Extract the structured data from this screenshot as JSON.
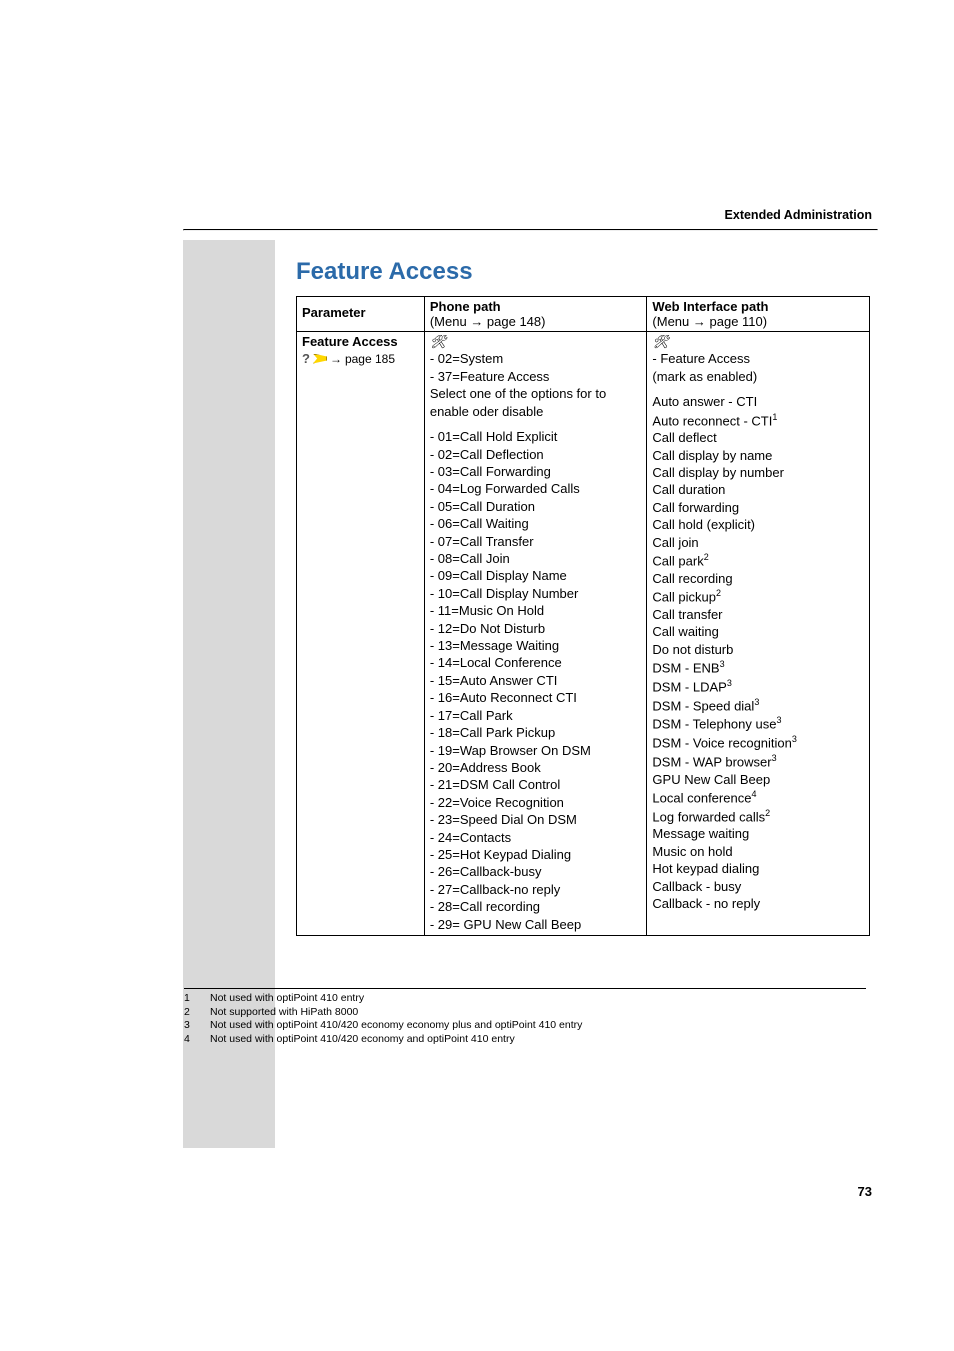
{
  "header": "Extended Administration",
  "title": "Feature Access",
  "columns": {
    "param": "Parameter",
    "phone": "Phone path",
    "phone_sub_prefix": "(Menu ",
    "phone_sub_page": " page 148)",
    "web": "Web Interface path",
    "web_sub_prefix": "(Menu ",
    "web_sub_page": " page 110)"
  },
  "row": {
    "param_title": "Feature Access",
    "param_link_prefix": " ",
    "param_link": "page 185",
    "phone_intro": [
      "- 02=System",
      "- 37=Feature Access",
      "Select one of the options for to enable oder disable"
    ],
    "phone_options": [
      "- 01=Call Hold Explicit",
      "- 02=Call Deflection",
      "- 03=Call Forwarding",
      "- 04=Log Forwarded Calls",
      "- 05=Call Duration",
      "- 06=Call Waiting",
      "- 07=Call Transfer",
      "- 08=Call Join",
      "- 09=Call Display Name",
      "- 10=Call Display Number",
      "- 11=Music On Hold",
      "- 12=Do Not Disturb",
      "- 13=Message Waiting",
      "- 14=Local Conference",
      "- 15=Auto Answer CTI",
      "- 16=Auto Reconnect CTI",
      "- 17=Call Park",
      "- 18=Call Park Pickup",
      "- 19=Wap Browser On DSM",
      "- 20=Address Book",
      "- 21=DSM Call Control",
      "- 22=Voice Recognition",
      "- 23=Speed Dial On DSM",
      "- 24=Contacts",
      "- 25=Hot Keypad Dialing",
      "- 26=Callback-busy",
      "- 27=Callback-no reply",
      "- 28=Call recording",
      "- 29= GPU New Call Beep"
    ],
    "web_intro": [
      "- Feature Access",
      "(mark as enabled)"
    ],
    "web_options": [
      {
        "t": "Auto answer - CTI",
        "s": ""
      },
      {
        "t": "Auto reconnect - CTI",
        "s": "1"
      },
      {
        "t": "Call deflect",
        "s": ""
      },
      {
        "t": "Call display by name",
        "s": ""
      },
      {
        "t": "Call display by number",
        "s": ""
      },
      {
        "t": "Call duration",
        "s": ""
      },
      {
        "t": "Call forwarding",
        "s": ""
      },
      {
        "t": "Call hold (explicit)",
        "s": ""
      },
      {
        "t": "Call join",
        "s": ""
      },
      {
        "t": "Call park",
        "s": "2"
      },
      {
        "t": "Call recording",
        "s": ""
      },
      {
        "t": "Call pickup",
        "s": "2"
      },
      {
        "t": "Call transfer",
        "s": ""
      },
      {
        "t": "Call waiting",
        "s": ""
      },
      {
        "t": "Do not disturb",
        "s": ""
      },
      {
        "t": "DSM - ENB",
        "s": "3"
      },
      {
        "t": "DSM - LDAP",
        "s": "3"
      },
      {
        "t": "DSM - Speed dial",
        "s": "3"
      },
      {
        "t": "DSM - Telephony use",
        "s": "3"
      },
      {
        "t": "DSM - Voice recognition",
        "s": "3"
      },
      {
        "t": "DSM - WAP browser",
        "s": "3"
      },
      {
        "t": "GPU New Call Beep",
        "s": ""
      },
      {
        "t": "Local conference",
        "s": "4"
      },
      {
        "t": "Log forwarded calls",
        "s": "2"
      },
      {
        "t": "Message waiting",
        "s": ""
      },
      {
        "t": "Music on hold",
        "s": ""
      },
      {
        "t": "Hot keypad dialing",
        "s": ""
      },
      {
        "t": "Callback - busy",
        "s": ""
      },
      {
        "t": "Callback - no reply",
        "s": ""
      }
    ]
  },
  "footnotes": [
    {
      "n": "1",
      "t": "Not used with optiPoint 410 entry"
    },
    {
      "n": "2",
      "t": "Not supported with HiPath 8000"
    },
    {
      "n": "3",
      "t": "Not used with optiPoint 410/420 economy economy plus and optiPoint 410 entry"
    },
    {
      "n": "4",
      "t": "Not used with optiPoint 410/420 economy and optiPoint 410 entry"
    }
  ],
  "page_number": "73",
  "arrow": "→"
}
